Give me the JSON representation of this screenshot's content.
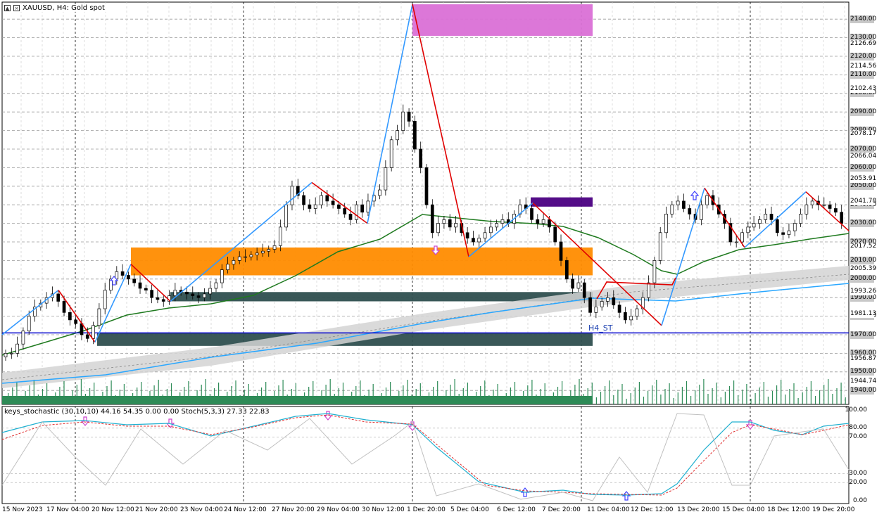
{
  "symbol": {
    "title": "XAUUSD, H4:  Gold spot"
  },
  "indicator": {
    "label": "keys_stochastic (30,10,10) 44.16 54.35 0.00 0.00 Stoch(5,3,3) 27.33 22.83"
  },
  "annotations": {
    "st_label": "H4_ST"
  },
  "colors": {
    "bull": "#ffffff",
    "bear": "#000000",
    "zigzag_up": "#3399ff",
    "zigzag_down": "#e00000",
    "ma_green": "#1f7a1f",
    "ma_blue": "#2aa7ff",
    "band": "#d3d3d3",
    "zone_orange": "#ff8c00",
    "zone_dark": "#2f4f4f",
    "zone_magenta": "#da70d6",
    "zone_purple": "#4b0082",
    "hline": "#0000cd",
    "volume": "#2e8b57"
  },
  "price_scale": {
    "highlighted": [
      "2140.00",
      "2130.00",
      "2120.00",
      "2110.00",
      "2100.00",
      "2090.00",
      "2080.00",
      "2070.00",
      "2060.00",
      "2050.00",
      "2040.00",
      "2030.00",
      "2020.00",
      "2010.00",
      "2000.00",
      "1990.00",
      "1980.00",
      "1970.00",
      "1960.00",
      "1950.00",
      "1940.00"
    ],
    "plain": [
      {
        "label": "2126.69",
        "value": 2126.69
      },
      {
        "label": "2114.56",
        "value": 2114.56
      },
      {
        "label": "2102.43",
        "value": 2102.43
      },
      {
        "label": "2078.17",
        "value": 2078.17
      },
      {
        "label": "2066.04",
        "value": 2066.04
      },
      {
        "label": "2053.91",
        "value": 2053.91
      },
      {
        "label": "2041.78",
        "value": 2041.78
      },
      {
        "label": "2017.52",
        "value": 2017.52
      },
      {
        "label": "2005.39",
        "value": 2005.39
      },
      {
        "label": "1993.26",
        "value": 1993.26
      },
      {
        "label": "1981.13",
        "value": 1981.13
      },
      {
        "label": "1956.87",
        "value": 1956.87
      },
      {
        "label": "1944.74",
        "value": 1944.74
      }
    ]
  },
  "osc_scale": [
    "100.00",
    "80.00",
    "70.00",
    "30.00",
    "20.00",
    "0.00"
  ],
  "time_axis": [
    "15 Nov 2023",
    "17 Nov 04:00",
    "20 Nov 12:00",
    "21 Nov 20:00",
    "23 Nov 04:00",
    "24 Nov 12:00",
    "27 Nov 20:00",
    "29 Nov 04:00",
    "30 Nov 12:00",
    "1 Dec 20:00",
    "5 Dec 04:00",
    "6 Dec 12:00",
    "7 Dec 20:00",
    "11 Dec 04:00",
    "12 Dec 12:00",
    "13 Dec 20:00",
    "15 Dec 04:00",
    "18 Dec 12:00",
    "19 Dec 20:00"
  ],
  "chart_data": {
    "type": "candlestick",
    "symbol": "XAUUSD",
    "timeframe": "H4",
    "zones": [
      {
        "color": "magenta",
        "from": 2131,
        "to": 2148
      },
      {
        "color": "purple",
        "from": 2039,
        "to": 2044
      },
      {
        "color": "orange",
        "from": 2002,
        "to": 2017
      },
      {
        "color": "darkslate",
        "from": 1988,
        "to": 1993
      },
      {
        "color": "darkslate",
        "from": 1964,
        "to": 1971
      }
    ],
    "horizontal_line": 1971,
    "zigzag_points": [
      1970,
      1994,
      1966,
      2008,
      1988,
      2052,
      2030,
      2148,
      2012,
      2041,
      1975,
      2049,
      2017,
      2047,
      2026
    ],
    "candles": [
      1960,
      1960,
      1965,
      1972,
      1980,
      1985,
      1987,
      1990,
      1992,
      1988,
      1982,
      1978,
      1976,
      1970,
      1968,
      1975,
      1984,
      1994,
      2000,
      2004,
      2002,
      2000,
      1998,
      1995,
      1994,
      1990,
      1989,
      1988,
      1991,
      1994,
      1993,
      1992,
      1991,
      1990,
      1992,
      1995,
      1998,
      2005,
      2008,
      2010,
      2012,
      2012,
      2013,
      2014,
      2015,
      2016,
      2018,
      2028,
      2040,
      2050,
      2045,
      2040,
      2038,
      2040,
      2045,
      2042,
      2040,
      2038,
      2035,
      2032,
      2040,
      2036,
      2042,
      2045,
      2048,
      2060,
      2075,
      2080,
      2090,
      2085,
      2070,
      2060,
      2040,
      2025,
      2030,
      2032,
      2028,
      2030,
      2025,
      2022,
      2020,
      2022,
      2025,
      2028,
      2030,
      2032,
      2030,
      2035,
      2040,
      2038,
      2032,
      2030,
      2032,
      2028,
      2020,
      2010,
      2000,
      1995,
      1998,
      1990,
      1982,
      1985,
      1988,
      1990,
      1986,
      1982,
      1978,
      1980,
      1984,
      1990,
      1998,
      2010,
      2025,
      2035,
      2040,
      2042,
      2038,
      2035,
      2032,
      2040,
      2045,
      2040,
      2035,
      2030,
      2020,
      2020,
      2025,
      2028,
      2030,
      2032,
      2035,
      2032,
      2025,
      2024,
      2026,
      2030,
      2035,
      2040,
      2042,
      2040,
      2040,
      2038,
      2036,
      2030
    ]
  }
}
